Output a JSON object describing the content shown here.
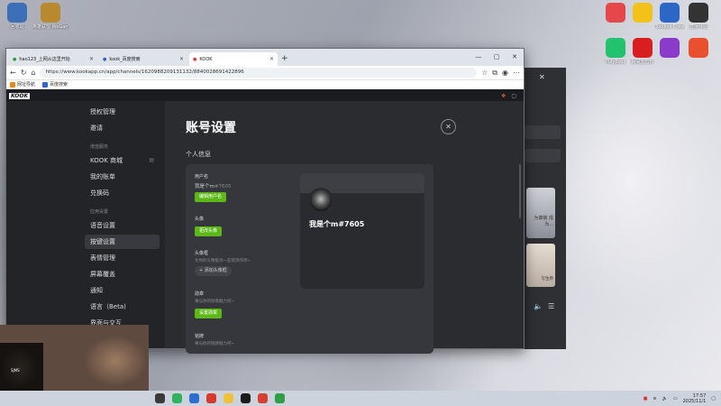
{
  "desktop": {
    "left_icons": [
      {
        "label": "回收站",
        "color": "#3d6fb8"
      },
      {
        "label": "英雄联盟 WeGame版",
        "color": "#b8892e"
      }
    ],
    "right_icons": [
      {
        "label": "",
        "color": "#e5474a"
      },
      {
        "label": "",
        "color": "#f2c21a"
      },
      {
        "label": "Toodles Crew",
        "color": "#2c66c7"
      },
      {
        "label": "直播伴侣",
        "color": "#333333"
      },
      {
        "label": "PolyBuzz",
        "color": "#23c26e"
      },
      {
        "label": "网易云音乐",
        "color": "#d81e1e"
      },
      {
        "label": "",
        "color": "#4da0e6"
      },
      {
        "label": "",
        "color": "#8a3bc9"
      },
      {
        "label": "",
        "color": "#e8502e"
      }
    ]
  },
  "browser": {
    "tabs": [
      {
        "label": "hao123_上网从这里开始",
        "active": false
      },
      {
        "label": "kook_百度搜索",
        "active": false
      },
      {
        "label": "KOOK",
        "active": true
      }
    ],
    "url": "https://www.kookapp.cn/app/channels/1620988209131132/8840028691422896",
    "bookmarks": [
      {
        "label": "网址导航",
        "color": "#e88a1a"
      },
      {
        "label": "百度搜索",
        "color": "#2e63d6"
      }
    ],
    "window_controls": [
      "—",
      "▢",
      "✕"
    ]
  },
  "kook": {
    "logo": "KOOK",
    "sidebar": {
      "items_top": [
        {
          "label": "授权管理"
        },
        {
          "label": "邀请"
        }
      ],
      "group_1": "增值服务",
      "items_mid": [
        {
          "label": "KOOK 商城"
        },
        {
          "label": "我的账单"
        },
        {
          "label": "兑换码"
        }
      ],
      "group_2": "应用设置",
      "items_bottom": [
        {
          "label": "语音设置"
        },
        {
          "label": "按键设置"
        },
        {
          "label": "表情管理"
        },
        {
          "label": "屏幕覆盖"
        },
        {
          "label": "通知"
        },
        {
          "label": "语言（Beta)"
        },
        {
          "label": "界面与交互"
        }
      ]
    },
    "settings": {
      "title": "账号设置",
      "close": "✕",
      "section": "个人信息",
      "username_label": "用户名",
      "username_value": "我是个m",
      "username_tag": "#7605",
      "edit_username": "编辑用户名",
      "avatar_label": "头像",
      "change_avatar": "更改头像",
      "frame_label": "头像框",
      "frame_hint": "为你的头像框添一些装饰作吧~",
      "add_frame": "+ 添加头像框",
      "medal_label": "勋章",
      "medal_hint": "事与你的勋章魅力吧~",
      "set_medal": "设置勋章",
      "nameplate_label": "铭牌",
      "nameplate_hint": "事与你的铭牌魅力吧~",
      "preview_name": "我是个m#7605"
    }
  },
  "background_app": {
    "image_caption_1": "为谁装 成为...",
    "image_caption_2": "写生原"
  },
  "webcam": {
    "tag": "SJMS"
  },
  "taskbar": {
    "apps": [
      "#3a3a3a",
      "#2fb35e",
      "#2d6fd1",
      "#d8392f",
      "#f0c23a",
      "#1c1c1c",
      "#d64032",
      "#2f9e44"
    ],
    "time": "17:57",
    "date": "2025/11/1"
  }
}
